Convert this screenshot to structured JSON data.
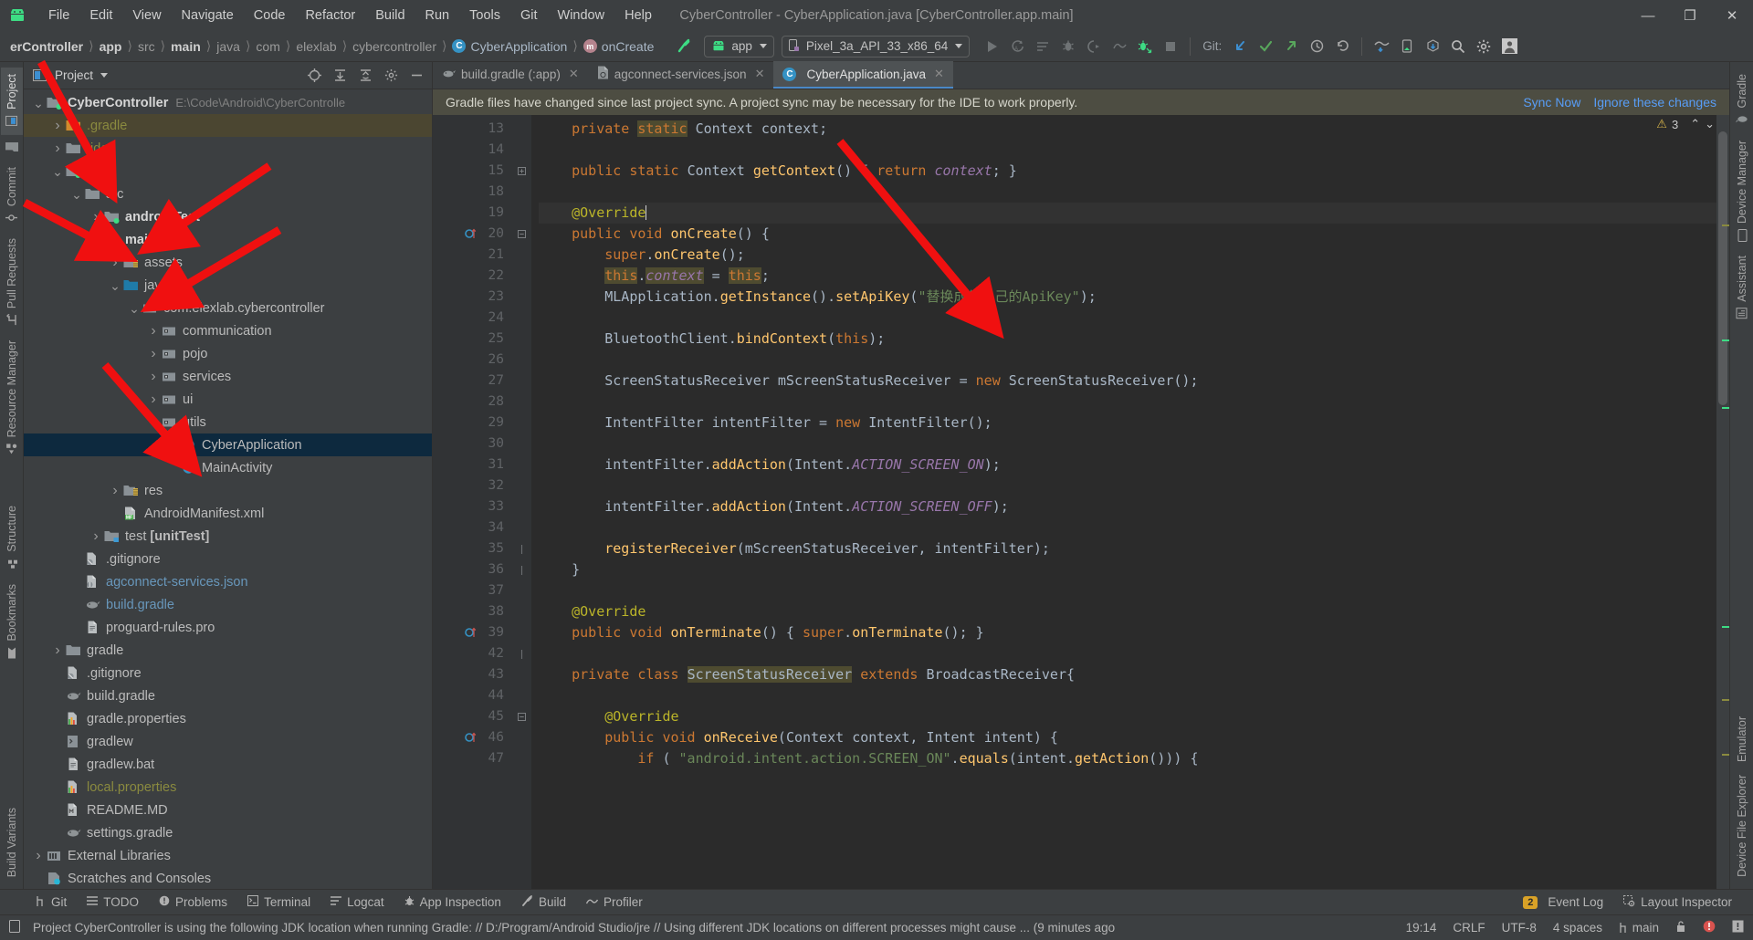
{
  "window": {
    "title": "CyberController - CyberApplication.java [CyberController.app.main]",
    "controls": {
      "minimize": "—",
      "maximize": "❐",
      "close": "✕"
    }
  },
  "menu": {
    "logo_icon": "android-robot-icon",
    "items": [
      "File",
      "Edit",
      "View",
      "Navigate",
      "Code",
      "Refactor",
      "Build",
      "Run",
      "Tools",
      "Git",
      "Window",
      "Help"
    ]
  },
  "navbar": {
    "breadcrumbs": [
      {
        "label": "erController",
        "style": "bold"
      },
      {
        "label": "app",
        "style": "bold"
      },
      {
        "label": "src",
        "style": "dim"
      },
      {
        "label": "main",
        "style": "bold"
      },
      {
        "label": "java",
        "style": "dim"
      },
      {
        "label": "com",
        "style": "dim"
      },
      {
        "label": "elexlab",
        "style": "dim"
      },
      {
        "label": "cybercontroller",
        "style": "dim"
      },
      {
        "label": "CyberApplication",
        "style": "class",
        "badge": "C"
      },
      {
        "label": "onCreate",
        "style": "method",
        "badge": "m"
      }
    ],
    "build_icon": "build-hammer-icon",
    "run_config": {
      "label": "app",
      "icon": "android-robot-icon"
    },
    "device": {
      "label": "Pixel_3a_API_33_x86_64",
      "icon": "device-phone-icon"
    },
    "actions": [
      {
        "name": "run-icon",
        "glyph": "▶"
      },
      {
        "name": "apply-changes-icon",
        "glyph": "⟳"
      },
      {
        "name": "apply-code-changes-icon",
        "glyph": "≡"
      },
      {
        "name": "debug-icon",
        "glyph": "⛏"
      },
      {
        "name": "run-with-coverage-icon",
        "glyph": "◑"
      },
      {
        "name": "profile-icon",
        "glyph": "∿"
      },
      {
        "name": "attach-debugger-icon",
        "glyph": "☘"
      },
      {
        "name": "stop-icon",
        "glyph": "■"
      }
    ],
    "git_label": "Git:",
    "git_actions": [
      {
        "name": "git-update-icon",
        "glyph": "↙",
        "color": "#3d8fd1"
      },
      {
        "name": "git-commit-icon",
        "glyph": "✓",
        "color": "#58a65c"
      },
      {
        "name": "git-push-icon",
        "glyph": "↗",
        "color": "#58a65c"
      },
      {
        "name": "git-history-icon",
        "glyph": "◴",
        "color": "#a6a6a6"
      },
      {
        "name": "git-rollback-icon",
        "glyph": "↶",
        "color": "#a6a6a6"
      }
    ],
    "right_actions": [
      {
        "name": "device-manager-icon",
        "glyph": "✇"
      },
      {
        "name": "device-file-explorer-icon",
        "glyph": "⬛"
      },
      {
        "name": "sdk-manager-icon",
        "glyph": "⬇"
      },
      {
        "name": "search-icon",
        "glyph": "⚲"
      },
      {
        "name": "gear-icon",
        "glyph": "⚙"
      },
      {
        "name": "avatar-icon",
        "glyph": "■"
      }
    ]
  },
  "left_tool_strip": [
    {
      "label": "Project",
      "icon": "project-icon",
      "active": true
    },
    {
      "label": "",
      "icon": "folder-icon",
      "active": false
    },
    {
      "label": "Commit",
      "icon": "commit-icon",
      "active": false
    },
    {
      "label": "Pull Requests",
      "icon": "pull-request-icon",
      "active": false
    },
    {
      "label": "Resource Manager",
      "icon": "resource-manager-icon",
      "active": false
    },
    {
      "label": "Structure",
      "icon": "structure-icon",
      "active": false
    },
    {
      "label": "Bookmarks",
      "icon": "bookmark-icon",
      "active": false
    },
    {
      "label": "Build Variants",
      "icon": "build-variants-icon",
      "active": false
    }
  ],
  "right_tool_strip": [
    {
      "label": "Gradle",
      "icon": "gradle-elephant-icon"
    },
    {
      "label": "Device Manager",
      "icon": "device-manager-icon"
    },
    {
      "label": "Assistant",
      "icon": "assistant-icon"
    },
    {
      "label": "Emulator",
      "icon": "emulator-icon"
    },
    {
      "label": "Device File Explorer",
      "icon": "device-file-explorer-icon"
    }
  ],
  "project_panel": {
    "title": "Project",
    "title_caret": "▾",
    "header_icons": [
      {
        "name": "select-opened-file-icon",
        "glyph": "⊕"
      },
      {
        "name": "expand-all-icon",
        "glyph": "⤓"
      },
      {
        "name": "collapse-all-icon",
        "glyph": "⤒"
      },
      {
        "name": "settings-gear-icon",
        "glyph": "⚙"
      },
      {
        "name": "hide-panel-icon",
        "glyph": "—"
      }
    ],
    "tree": [
      {
        "depth": 0,
        "arrow": "down",
        "icon": "module-folder-icon",
        "label": "CyberController",
        "bold": true,
        "path": "E:\\Code\\Android\\CyberControlle"
      },
      {
        "depth": 1,
        "arrow": "right",
        "icon": "gradle-folder-icon",
        "label": ".gradle",
        "color": "olive",
        "highlight": true
      },
      {
        "depth": 1,
        "arrow": "right",
        "icon": "folder-icon",
        "label": ".idea",
        "color": "olive"
      },
      {
        "depth": 1,
        "arrow": "down",
        "icon": "module-folder-icon",
        "label": "app",
        "bold": true
      },
      {
        "depth": 2,
        "arrow": "down",
        "icon": "folder-icon",
        "label": "src"
      },
      {
        "depth": 3,
        "arrow": "right",
        "icon": "module-folder-icon",
        "label": "androidTest",
        "bold": true
      },
      {
        "depth": 3,
        "arrow": "down",
        "icon": "module-folder-icon",
        "label": "main",
        "bold": true
      },
      {
        "depth": 4,
        "arrow": "right",
        "icon": "assets-folder-icon",
        "label": "assets"
      },
      {
        "depth": 4,
        "arrow": "down",
        "icon": "source-folder-icon",
        "label": "java"
      },
      {
        "depth": 5,
        "arrow": "down",
        "icon": "package-icon",
        "label": "com.elexlab.cybercontroller"
      },
      {
        "depth": 6,
        "arrow": "right",
        "icon": "package-icon",
        "label": "communication"
      },
      {
        "depth": 6,
        "arrow": "right",
        "icon": "package-icon",
        "label": "pojo"
      },
      {
        "depth": 6,
        "arrow": "right",
        "icon": "package-icon",
        "label": "services"
      },
      {
        "depth": 6,
        "arrow": "right",
        "icon": "package-icon",
        "label": "ui"
      },
      {
        "depth": 6,
        "arrow": "right",
        "icon": "package-icon",
        "label": "utils"
      },
      {
        "depth": 7,
        "arrow": "none",
        "icon": "java-class-icon",
        "label": "CyberApplication",
        "selected": true
      },
      {
        "depth": 7,
        "arrow": "none",
        "icon": "java-class-icon",
        "label": "MainActivity"
      },
      {
        "depth": 4,
        "arrow": "right",
        "icon": "res-folder-icon",
        "label": "res"
      },
      {
        "depth": 4,
        "arrow": "none",
        "icon": "manifest-icon",
        "label": "AndroidManifest.xml"
      },
      {
        "depth": 3,
        "arrow": "right",
        "icon": "test-folder-icon",
        "label": "test [unitTest]",
        "bold_suffix": true
      },
      {
        "depth": 2,
        "arrow": "none",
        "icon": "gitignore-icon",
        "label": ".gitignore"
      },
      {
        "depth": 2,
        "arrow": "none",
        "icon": "json-icon",
        "label": "agconnect-services.json",
        "color": "blue"
      },
      {
        "depth": 2,
        "arrow": "none",
        "icon": "gradle-file-icon",
        "label": "build.gradle",
        "color": "blue"
      },
      {
        "depth": 2,
        "arrow": "none",
        "icon": "text-file-icon",
        "label": "proguard-rules.pro"
      },
      {
        "depth": 1,
        "arrow": "right",
        "icon": "folder-icon",
        "label": "gradle"
      },
      {
        "depth": 1,
        "arrow": "none",
        "icon": "gitignore-icon",
        "label": ".gitignore"
      },
      {
        "depth": 1,
        "arrow": "none",
        "icon": "gradle-file-icon",
        "label": "build.gradle"
      },
      {
        "depth": 1,
        "arrow": "none",
        "icon": "properties-icon",
        "label": "gradle.properties"
      },
      {
        "depth": 1,
        "arrow": "none",
        "icon": "script-icon",
        "label": "gradlew"
      },
      {
        "depth": 1,
        "arrow": "none",
        "icon": "text-file-icon",
        "label": "gradlew.bat"
      },
      {
        "depth": 1,
        "arrow": "none",
        "icon": "properties-icon",
        "label": "local.properties",
        "color": "olive"
      },
      {
        "depth": 1,
        "arrow": "none",
        "icon": "markdown-icon",
        "label": "README.MD"
      },
      {
        "depth": 1,
        "arrow": "none",
        "icon": "gradle-file-icon",
        "label": "settings.gradle"
      },
      {
        "depth": 0,
        "arrow": "right",
        "icon": "library-icon",
        "label": "External Libraries"
      },
      {
        "depth": 0,
        "arrow": "none",
        "icon": "scratches-icon",
        "label": "Scratches and Consoles"
      }
    ]
  },
  "editor": {
    "tabs": [
      {
        "label": "build.gradle (:app)",
        "icon": "gradle-file-icon",
        "active": false,
        "close": "✕"
      },
      {
        "label": "agconnect-services.json",
        "icon": "json-icon",
        "active": false,
        "close": "✕"
      },
      {
        "label": "CyberApplication.java",
        "icon": "java-class-icon",
        "active": true,
        "close": "✕"
      }
    ],
    "banner": {
      "message": "Gradle files have changed since last project sync. A project sync may be necessary for the IDE to work properly.",
      "sync_now": "Sync Now",
      "ignore": "Ignore these changes"
    },
    "inspection": {
      "warning_count": "3",
      "warning_glyph": "⚠",
      "up": "⌃",
      "down": "⌄"
    },
    "line_numbers": [
      "13",
      "14",
      "15",
      "18",
      "19",
      "20",
      "21",
      "22",
      "23",
      "24",
      "25",
      "26",
      "27",
      "28",
      "29",
      "30",
      "31",
      "32",
      "33",
      "34",
      "35",
      "36",
      "37",
      "38",
      "39",
      "42",
      "43",
      "44",
      "45",
      "46",
      "47"
    ],
    "code_lines": [
      "    private static Context context;",
      "",
      "    public static Context getContext() { return context; }",
      "",
      "    @Override",
      "    public void onCreate() {",
      "        super.onCreate();",
      "        this.context = this;",
      "        MLApplication.getInstance().setApiKey(\"替换成你自己的ApiKey\");",
      "",
      "        BluetoothClient.bindContext(this);",
      "",
      "        ScreenStatusReceiver mScreenStatusReceiver = new ScreenStatusReceiver();",
      "",
      "        IntentFilter intentFilter = new IntentFilter();",
      "",
      "        intentFilter.addAction(Intent.ACTION_SCREEN_ON);",
      "",
      "        intentFilter.addAction(Intent.ACTION_SCREEN_OFF);",
      "",
      "        registerReceiver(mScreenStatusReceiver, intentFilter);",
      "    }",
      "",
      "    @Override",
      "    public void onTerminate() { super.onTerminate(); }",
      "",
      "    private class ScreenStatusReceiver extends BroadcastReceiver{",
      "",
      "        @Override",
      "        public void onReceive(Context context, Intent intent) {",
      "            if ( \"android.intent.action.SCREEN_ON\".equals(intent.getAction())) {"
    ]
  },
  "bottom_bar": {
    "items": [
      {
        "label": "Git",
        "icon": "git-branch-icon"
      },
      {
        "label": "TODO",
        "icon": "todo-list-icon"
      },
      {
        "label": "Problems",
        "icon": "problems-icon"
      },
      {
        "label": "Terminal",
        "icon": "terminal-icon"
      },
      {
        "label": "Logcat",
        "icon": "logcat-icon"
      },
      {
        "label": "App Inspection",
        "icon": "app-inspection-icon"
      },
      {
        "label": "Build",
        "icon": "build-hammer-icon"
      },
      {
        "label": "Profiler",
        "icon": "profiler-icon"
      }
    ],
    "event_log": {
      "label": "Event Log",
      "count": "2"
    },
    "layout_inspector": {
      "label": "Layout Inspector",
      "icon": "layout-inspector-icon"
    }
  },
  "status_bar": {
    "icon": "info-icon",
    "message": "Project CyberController is using the following JDK location when running Gradle: // D:/Program/Android Studio/jre // Using different JDK locations on different processes might cause ... (9 minutes ago",
    "time": "19:14",
    "line_separator": "CRLF",
    "encoding": "UTF-8",
    "indent": "4 spaces",
    "branch": "main",
    "branch_icon": "git-branch-icon",
    "lock_icon": "lock-icon",
    "error_icon": "error-circle-icon",
    "notification_icon": "notification-icon"
  },
  "colors": {
    "accent_blue": "#4a88c7",
    "selection": "#0d293e",
    "annotation_red": "#f01010",
    "banner_bg": "#4d4d42",
    "editor_bg": "#2b2b2b",
    "panel_bg": "#3c3f41"
  }
}
